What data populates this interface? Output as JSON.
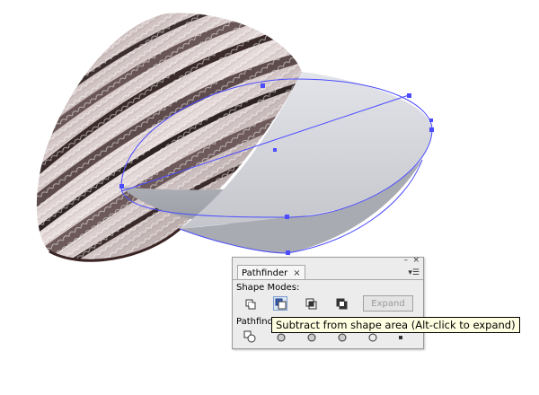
{
  "panel": {
    "tab_label": "Pathfinder",
    "tab_close": "×",
    "menu_glyph": "▾☰",
    "minimize_glyph": "–",
    "close_glyph": "×",
    "shape_modes_label": "Shape Modes:",
    "pathfinders_label": "Pathfind",
    "expand_label": "Expand",
    "shape_mode_buttons": [
      "add-to-shape-area",
      "subtract-from-shape-area",
      "intersect-shape-areas",
      "exclude-overlapping-areas"
    ],
    "active_mode": "subtract-from-shape-area"
  },
  "tooltip": {
    "text": "Subtract from shape area (Alt-click to expand)"
  },
  "colors": {
    "selection": "#4b4bff",
    "shell_dark": "#5a4848",
    "shell_light": "#ddd2d2",
    "cut_face": "#d6d8de"
  }
}
